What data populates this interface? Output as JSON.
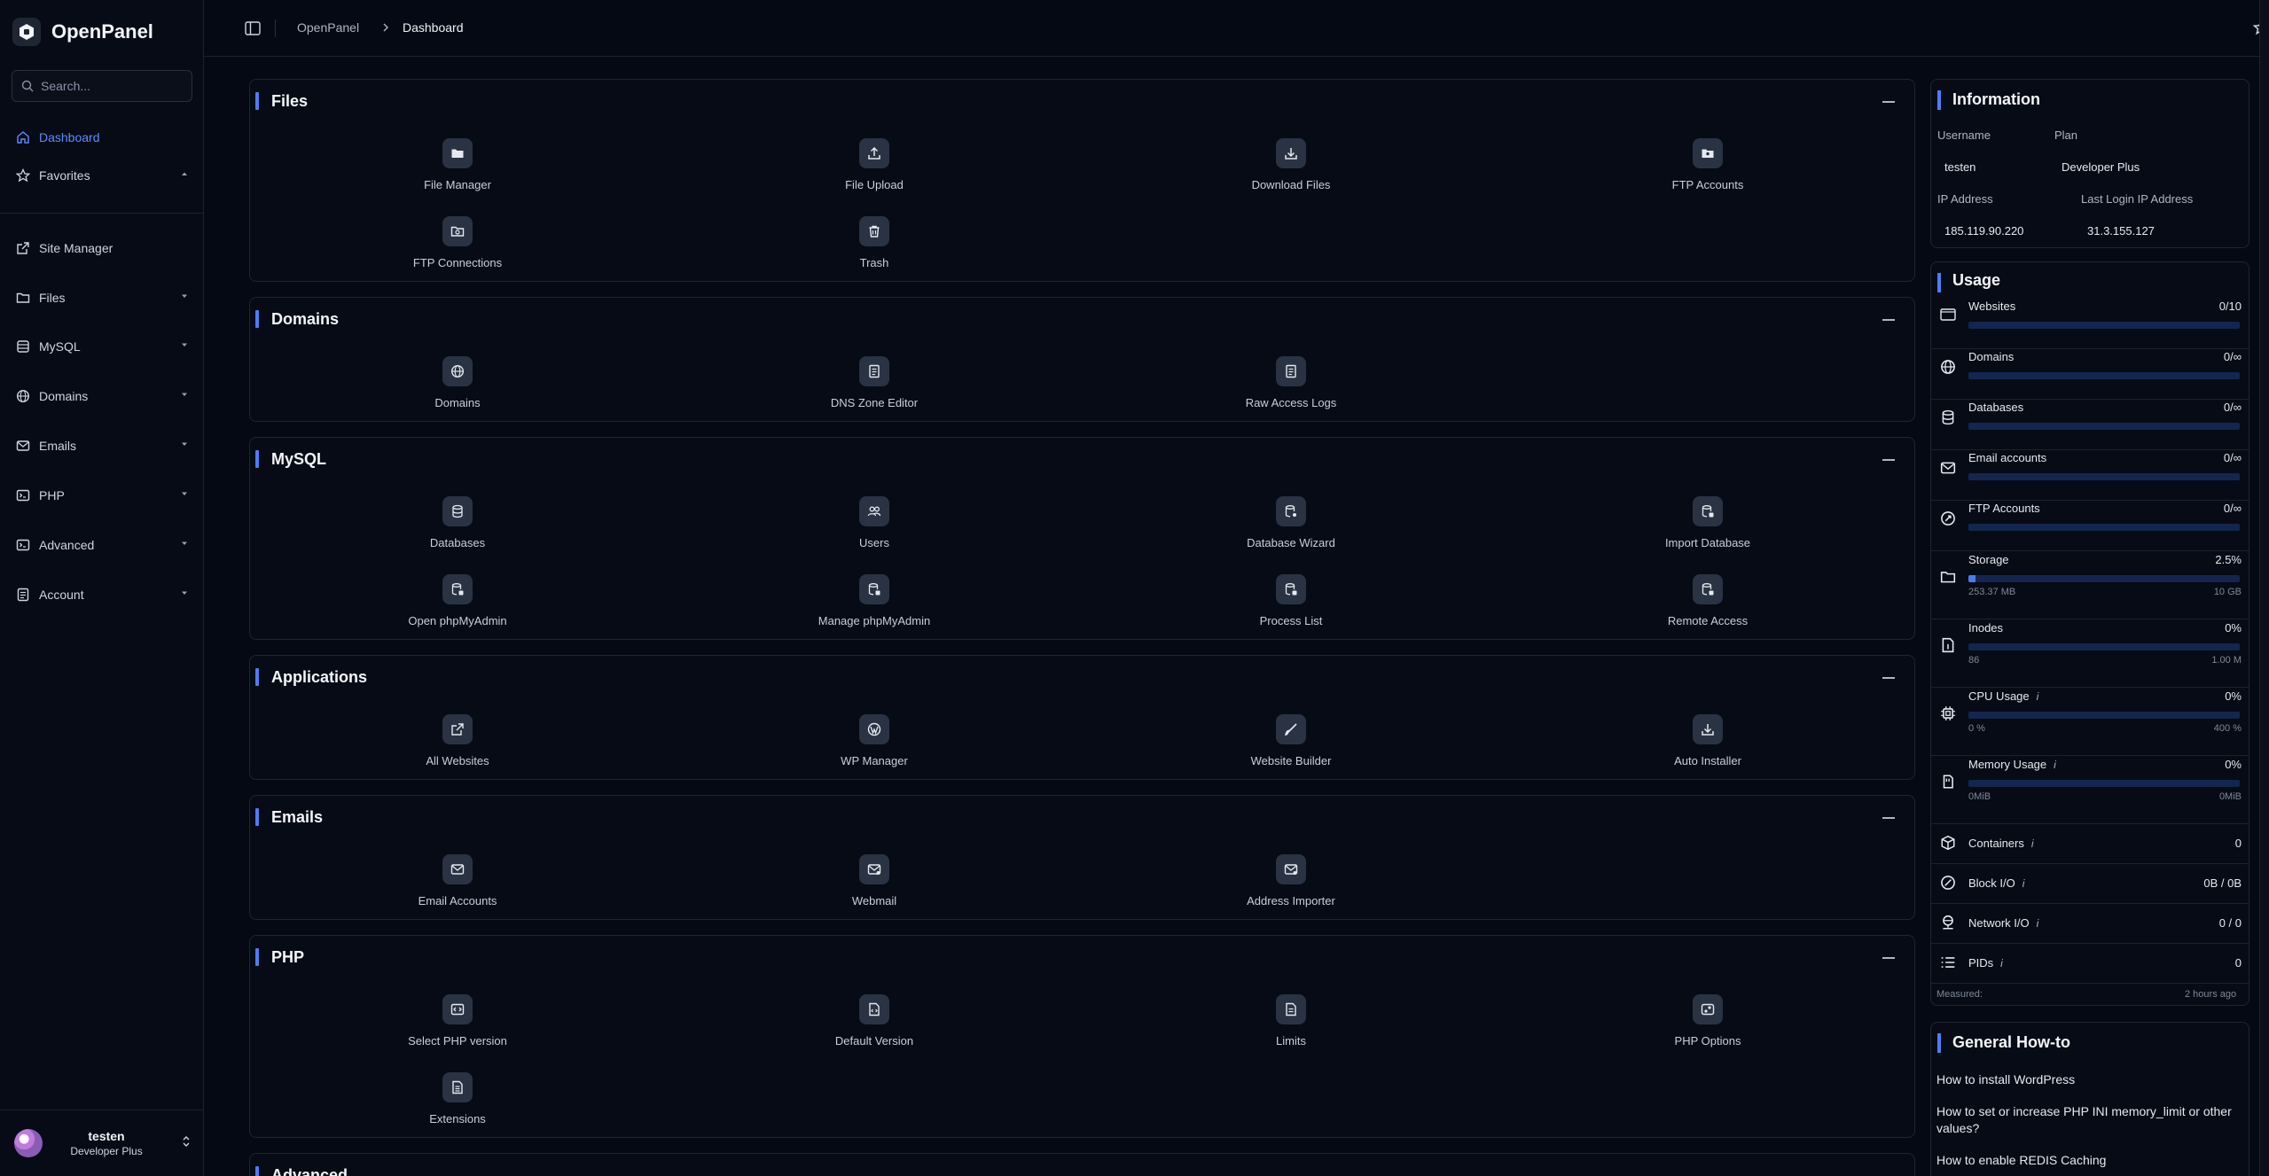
{
  "app": {
    "name": "OpenPanel"
  },
  "search": {
    "placeholder": "Search..."
  },
  "sidebar": {
    "items": [
      {
        "label": "Dashboard",
        "icon": "home-icon",
        "active": true
      },
      {
        "label": "Favorites",
        "icon": "star-icon",
        "expanded": true
      },
      {
        "label": "Site Manager",
        "icon": "external-link-icon"
      },
      {
        "label": "Files",
        "icon": "folder-icon"
      },
      {
        "label": "MySQL",
        "icon": "database-icon"
      },
      {
        "label": "Domains",
        "icon": "globe-icon"
      },
      {
        "label": "Emails",
        "icon": "mail-icon"
      },
      {
        "label": "PHP",
        "icon": "terminal-icon"
      },
      {
        "label": "Advanced",
        "icon": "terminal-icon"
      },
      {
        "label": "Account",
        "icon": "id-card-icon"
      }
    ]
  },
  "user": {
    "name": "testen",
    "plan": "Developer Plus"
  },
  "breadcrumb": {
    "root": "OpenPanel",
    "current": "Dashboard"
  },
  "sections": {
    "files": {
      "title": "Files",
      "tiles": [
        "File Manager",
        "File Upload",
        "Download Files",
        "FTP Accounts",
        "FTP Connections",
        "Trash"
      ]
    },
    "domains": {
      "title": "Domains",
      "tiles": [
        "Domains",
        "DNS Zone Editor",
        "Raw Access Logs"
      ]
    },
    "mysql": {
      "title": "MySQL",
      "tiles": [
        "Databases",
        "Users",
        "Database Wizard",
        "Import Database",
        "Open phpMyAdmin",
        "Manage phpMyAdmin",
        "Process List",
        "Remote Access"
      ]
    },
    "applications": {
      "title": "Applications",
      "tiles": [
        "All Websites",
        "WP Manager",
        "Website Builder",
        "Auto Installer"
      ]
    },
    "emails": {
      "title": "Emails",
      "tiles": [
        "Email Accounts",
        "Webmail",
        "Address Importer"
      ]
    },
    "php": {
      "title": "PHP",
      "tiles": [
        "Select PHP version",
        "Default Version",
        "Limits",
        "PHP Options",
        "Extensions"
      ]
    },
    "advanced": {
      "title": "Advanced"
    }
  },
  "information": {
    "title": "Information",
    "username_label": "Username",
    "username": "testen",
    "plan_label": "Plan",
    "plan": "Developer Plus",
    "ip_label": "IP Address",
    "ip": "185.119.90.220",
    "last_login_label": "Last Login IP Address",
    "last_login_ip": "31.3.155.127"
  },
  "usage": {
    "title": "Usage",
    "bars": [
      {
        "label": "Websites",
        "value": "0/10",
        "fill": 0
      },
      {
        "label": "Domains",
        "value": "0/∞",
        "fill": 0
      },
      {
        "label": "Databases",
        "value": "0/∞",
        "fill": 0
      },
      {
        "label": "Email accounts",
        "value": "0/∞",
        "fill": 0
      },
      {
        "label": "FTP Accounts",
        "value": "0/∞",
        "fill": 0
      },
      {
        "label": "Storage",
        "value": "2.5%",
        "fill": 0.025,
        "min": "253.37 MB",
        "max": "10 GB"
      },
      {
        "label": "Inodes",
        "value": "0%",
        "fill": 0,
        "min": "86",
        "max": "1.00 M"
      },
      {
        "label": "CPU Usage",
        "value": "0%",
        "fill": 0,
        "min": "0 %",
        "max": "400 %",
        "info": "i"
      },
      {
        "label": "Memory Usage",
        "value": "0%",
        "fill": 0,
        "min": "0MiB",
        "max": "0MiB",
        "info": "i"
      }
    ],
    "stats": [
      {
        "label": "Containers",
        "value": "0",
        "info": "i"
      },
      {
        "label": "Block I/O",
        "value": "0B / 0B",
        "info": "i"
      },
      {
        "label": "Network I/O",
        "value": "0 / 0",
        "info": "i"
      },
      {
        "label": "PIDs",
        "value": "0",
        "info": "i"
      }
    ],
    "measured_label": "Measured:",
    "measured_value": "2 hours ago"
  },
  "howto": {
    "title": "General How-to",
    "links": [
      "How to install WordPress",
      "How to set or increase PHP INI memory_limit or other values?",
      "How to enable REDIS Caching"
    ]
  },
  "colors": {
    "accent": "#4f7cf7",
    "background": "#050914",
    "tile_icon_bg": "#2a3343"
  }
}
